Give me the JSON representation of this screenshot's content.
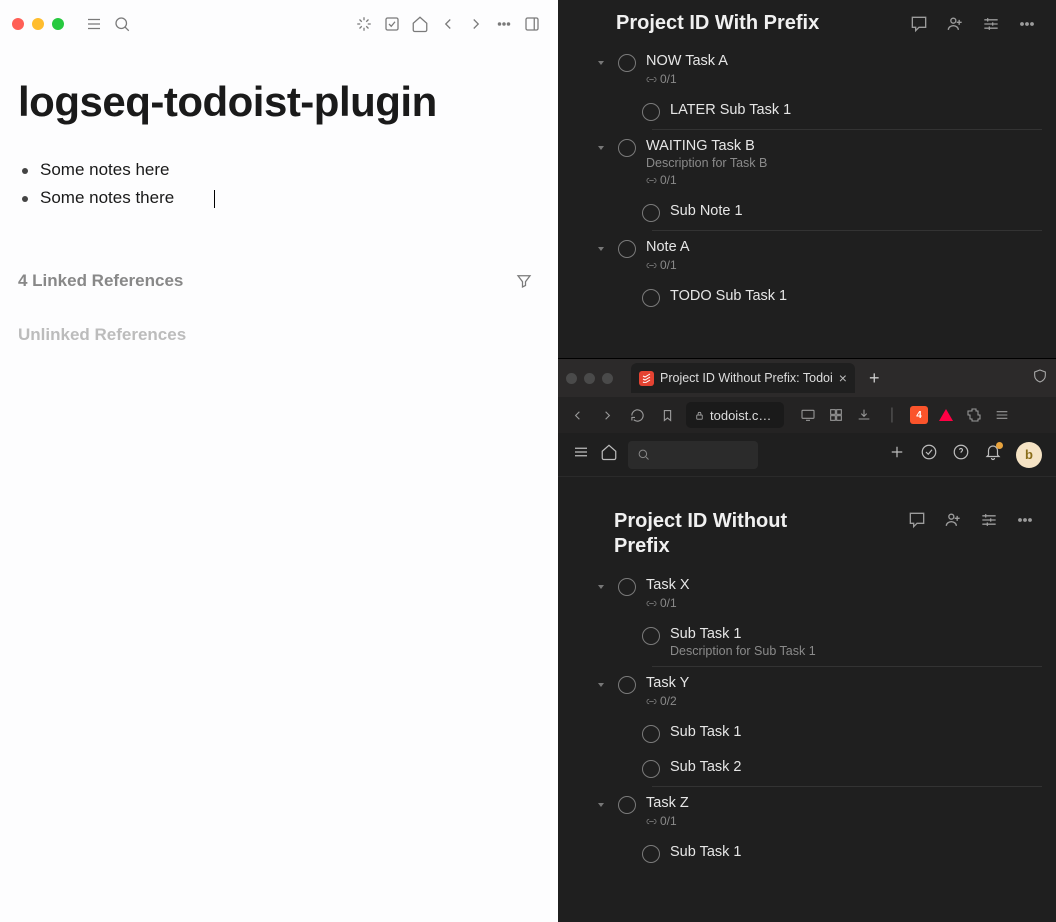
{
  "logseq": {
    "title": "logseq-todoist-plugin",
    "bullets": [
      "Some notes here",
      "Some notes there"
    ],
    "linked_refs_label": "4 Linked References",
    "unlinked_refs_label": "Unlinked References"
  },
  "todoist_top": {
    "project_title": "Project ID With Prefix",
    "tasks": [
      {
        "name": "NOW Task A",
        "count": "0/1",
        "subs": [
          {
            "name": "LATER Sub Task 1"
          }
        ]
      },
      {
        "name": "WAITING Task B",
        "desc": "Description for Task B",
        "count": "0/1",
        "subs": [
          {
            "name": "Sub Note 1"
          }
        ]
      },
      {
        "name": "Note A",
        "count": "0/1",
        "subs": [
          {
            "name": "TODO Sub Task 1"
          }
        ]
      }
    ]
  },
  "browser": {
    "tab_title": "Project ID Without Prefix: Todoi",
    "url_display": "todoist.c…",
    "brave_badge": "4",
    "avatar_letter": "b"
  },
  "todoist_bottom": {
    "project_title": "Project ID Without Prefix",
    "tasks": [
      {
        "name": "Task X",
        "count": "0/1",
        "subs": [
          {
            "name": "Sub Task 1",
            "desc": "Description for Sub Task 1"
          }
        ]
      },
      {
        "name": "Task Y",
        "count": "0/2",
        "subs": [
          {
            "name": "Sub Task 1"
          },
          {
            "name": "Sub Task 2"
          }
        ]
      },
      {
        "name": "Task Z",
        "count": "0/1",
        "subs": [
          {
            "name": "Sub Task 1"
          }
        ]
      }
    ]
  }
}
